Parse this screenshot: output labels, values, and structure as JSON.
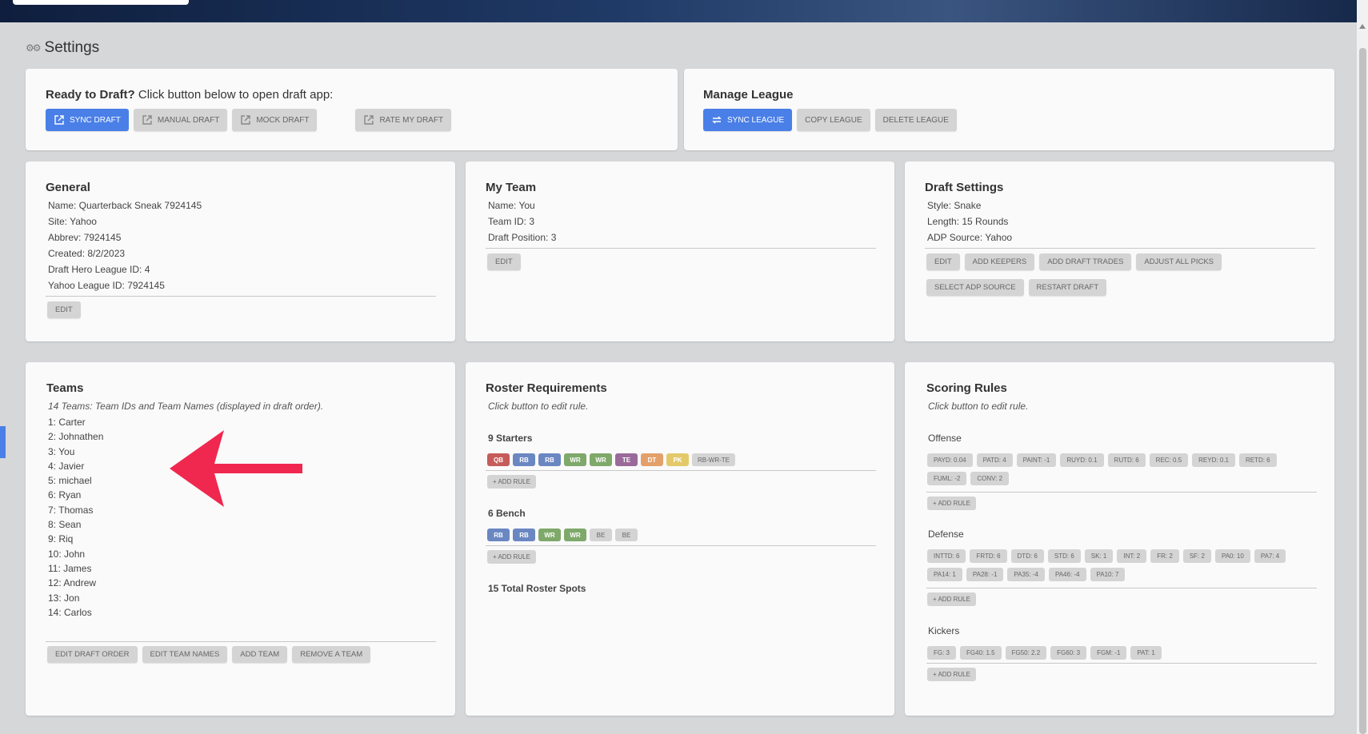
{
  "page": {
    "title": "Settings",
    "title_icon": "gears-icon"
  },
  "colors": {
    "primary": "#4a7fe8",
    "QB": "#c65b5b",
    "RB": "#6a87c2",
    "WR": "#7fa96b",
    "TE": "#9a6a9a",
    "DT": "#e4a06a",
    "PK": "#e4c96a",
    "arrow": "#f0284f"
  },
  "ready": {
    "title_bold": "Ready to Draft?",
    "title_rest": " Click button below to open draft app:",
    "buttons": [
      "SYNC DRAFT",
      "MANUAL DRAFT",
      "MOCK DRAFT",
      "RATE MY DRAFT"
    ]
  },
  "manage": {
    "title": "Manage League",
    "buttons": [
      "SYNC LEAGUE",
      "COPY LEAGUE",
      "DELETE LEAGUE"
    ]
  },
  "general": {
    "title": "General",
    "lines": [
      "Name: Quarterback Sneak 7924145",
      "Site: Yahoo",
      "Abbrev: 7924145",
      "Created: 8/2/2023",
      "Draft Hero League ID: 4",
      "Yahoo League ID: 7924145"
    ],
    "edit": "EDIT"
  },
  "myteam": {
    "title": "My Team",
    "lines": [
      "Name: You",
      "Team ID: 3",
      "Draft Position: 3"
    ],
    "edit": "EDIT"
  },
  "draftsettings": {
    "title": "Draft Settings",
    "lines": [
      "Style: Snake",
      "Length: 15 Rounds",
      "ADP Source: Yahoo"
    ],
    "buttons": [
      "EDIT",
      "ADD KEEPERS",
      "ADD DRAFT TRADES",
      "ADJUST ALL PICKS",
      "SELECT ADP SOURCE",
      "RESTART DRAFT"
    ]
  },
  "teams": {
    "title": "Teams",
    "note": "14 Teams: Team IDs and Team Names (displayed in draft order).",
    "list": [
      "1: Carter",
      "2: Johnathen",
      "3: You",
      "4: Javier",
      "5: michael",
      "6: Ryan",
      "7: Thomas",
      "8: Sean",
      "9: Riq",
      "10: John",
      "11: James",
      "12: Andrew",
      "13: Jon",
      "14: Carlos"
    ],
    "buttons": [
      "EDIT DRAFT ORDER",
      "EDIT TEAM NAMES",
      "ADD TEAM",
      "REMOVE A TEAM"
    ]
  },
  "roster": {
    "title": "Roster Requirements",
    "note": "Click button to edit rule.",
    "starters_label": "9 Starters",
    "starters": [
      {
        "label": "QB",
        "color": "#c65b5b"
      },
      {
        "label": "RB",
        "color": "#6a87c2"
      },
      {
        "label": "RB",
        "color": "#6a87c2"
      },
      {
        "label": "WR",
        "color": "#7fa96b"
      },
      {
        "label": "WR",
        "color": "#7fa96b"
      },
      {
        "label": "TE",
        "color": "#9a6a9a"
      },
      {
        "label": "DT",
        "color": "#e4a06a"
      },
      {
        "label": "PK",
        "color": "#e4c96a"
      },
      {
        "label": "RB-WR-TE",
        "color": "grey"
      }
    ],
    "bench_label": "6 Bench",
    "bench": [
      {
        "label": "RB",
        "color": "#6a87c2"
      },
      {
        "label": "RB",
        "color": "#6a87c2"
      },
      {
        "label": "WR",
        "color": "#7fa96b"
      },
      {
        "label": "WR",
        "color": "#7fa96b"
      },
      {
        "label": "BE",
        "color": "grey"
      },
      {
        "label": "BE",
        "color": "grey"
      }
    ],
    "add_rule": "+ ADD RULE",
    "total": "15 Total Roster Spots"
  },
  "scoring": {
    "title": "Scoring Rules",
    "note": "Click button to edit rule.",
    "offense_label": "Offense",
    "offense": [
      "PAYD: 0.04",
      "PATD: 4",
      "PAINT: -1",
      "RUYD: 0.1",
      "RUTD: 6",
      "REC: 0.5",
      "REYD: 0.1",
      "RETD: 6",
      "FUML: -2",
      "CONV: 2"
    ],
    "defense_label": "Defense",
    "defense": [
      "INTTD: 6",
      "FRTD: 6",
      "DTD: 6",
      "STD: 6",
      "SK: 1",
      "INT: 2",
      "FR: 2",
      "SF: 2",
      "PA0: 10",
      "PA7: 4",
      "PA14: 1",
      "PA28: -1",
      "PA35: -4",
      "PA46: -4",
      "PA10: 7"
    ],
    "kickers_label": "Kickers",
    "kickers": [
      "FG: 3",
      "FG40: 1.5",
      "FG50: 2.2",
      "FG60: 3",
      "FGM: -1",
      "PAT: 1"
    ],
    "add_rule": "+ ADD RULE"
  }
}
